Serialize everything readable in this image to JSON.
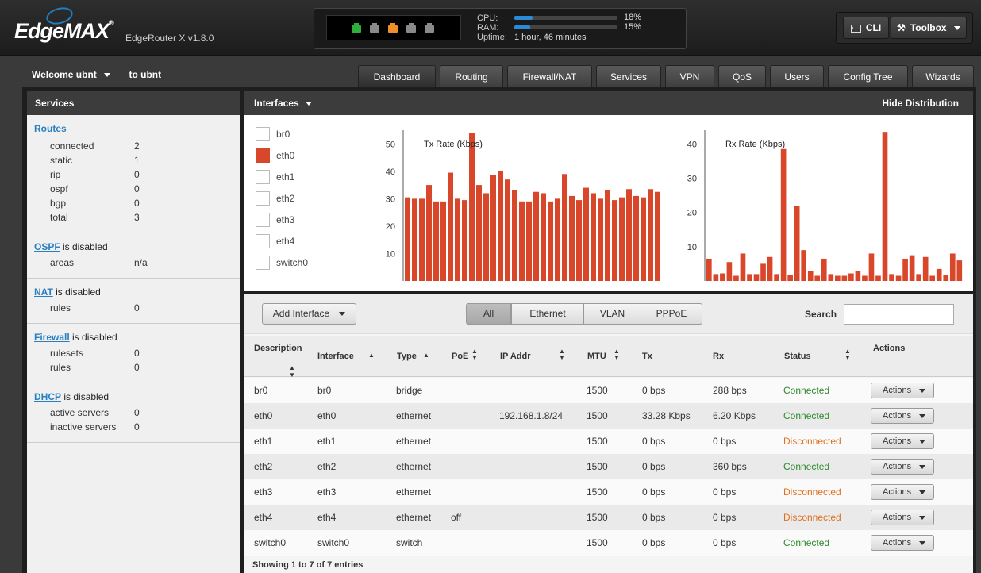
{
  "header": {
    "logo": "EdgeMAX",
    "model": "EdgeRouter X v1.8.0",
    "cpu_label": "CPU:",
    "ram_label": "RAM:",
    "uptime_label": "Uptime:",
    "cpu_pct": "18%",
    "ram_pct": "15%",
    "cpu_level": 0.18,
    "ram_level": 0.15,
    "uptime": "1 hour, 46 minutes",
    "ports": [
      {
        "color": "#2fae3c"
      },
      {
        "color": "#8a8a8a"
      },
      {
        "color": "#f0902a"
      },
      {
        "color": "#8a8a8a"
      },
      {
        "color": "#8a8a8a"
      }
    ],
    "cli_label": "CLI",
    "toolbox_label": "Toolbox"
  },
  "user": {
    "welcome": "Welcome ubnt",
    "to": "to ubnt"
  },
  "tabs": [
    "Dashboard",
    "Routing",
    "Firewall/NAT",
    "Services",
    "VPN",
    "QoS",
    "Users",
    "Config Tree",
    "Wizards"
  ],
  "services": {
    "title": "Services",
    "routes": {
      "title": "Routes",
      "rows": [
        {
          "k": "connected",
          "v": "2"
        },
        {
          "k": "static",
          "v": "1"
        },
        {
          "k": "rip",
          "v": "0"
        },
        {
          "k": "ospf",
          "v": "0"
        },
        {
          "k": "bgp",
          "v": "0"
        },
        {
          "k": "total",
          "v": "3"
        }
      ]
    },
    "ospf": {
      "title": "OSPF",
      "suffix": " is disabled",
      "rows": [
        {
          "k": "areas",
          "v": "n/a"
        }
      ]
    },
    "nat": {
      "title": "NAT",
      "suffix": " is disabled",
      "rows": [
        {
          "k": "rules",
          "v": "0"
        }
      ]
    },
    "firewall": {
      "title": "Firewall",
      "suffix": " is disabled",
      "rows": [
        {
          "k": "rulesets",
          "v": "0"
        },
        {
          "k": "rules",
          "v": "0"
        }
      ]
    },
    "dhcp": {
      "title": "DHCP",
      "suffix": " is disabled",
      "rows": [
        {
          "k": "active servers",
          "v": "0"
        },
        {
          "k": "inactive servers",
          "v": "0"
        }
      ]
    }
  },
  "interfaces_panel": {
    "title": "Interfaces",
    "hide_link": "Hide Distribution",
    "legend": [
      {
        "name": "br0",
        "checked": false
      },
      {
        "name": "eth0",
        "checked": true
      },
      {
        "name": "eth1",
        "checked": false
      },
      {
        "name": "eth2",
        "checked": false
      },
      {
        "name": "eth3",
        "checked": false
      },
      {
        "name": "eth4",
        "checked": false
      },
      {
        "name": "switch0",
        "checked": false
      }
    ],
    "bar_color": "#d9472b"
  },
  "chart_data": [
    {
      "type": "bar",
      "title": "Tx Rate (Kbps)",
      "series": [
        {
          "name": "eth0",
          "values": [
            30.5,
            30,
            30,
            35,
            29,
            29,
            39.5,
            30,
            29.5,
            54,
            35,
            32,
            38.5,
            40,
            37,
            33,
            29,
            29,
            32.5,
            32,
            29,
            30,
            39,
            31,
            29.5,
            34,
            32,
            30,
            33,
            29.5,
            30.5,
            33.5,
            31,
            30.5,
            33.5,
            32.5
          ]
        }
      ],
      "yticks": [
        10,
        20,
        30,
        40,
        50
      ],
      "ylim": [
        0,
        55
      ]
    },
    {
      "type": "bar",
      "title": "Rx Rate (Kbps)",
      "series": [
        {
          "name": "eth0",
          "values": [
            6.5,
            2,
            2.2,
            5.5,
            1.5,
            8,
            2,
            2,
            5,
            7,
            2,
            38.5,
            1.7,
            22,
            9,
            3,
            1.5,
            6.5,
            2,
            1.5,
            1.5,
            2.2,
            3,
            1.5,
            8,
            1.5,
            43.5,
            2,
            1.5,
            6.5,
            7.5,
            2,
            7,
            1.5,
            3.5,
            1.8,
            8,
            6
          ]
        }
      ],
      "yticks": [
        10,
        20,
        30,
        40
      ],
      "ylim": [
        0,
        44
      ]
    }
  ],
  "table": {
    "add_button": "Add Interface",
    "filters": [
      "All",
      "Ethernet",
      "VLAN",
      "PPPoE"
    ],
    "search_label": "Search",
    "columns": {
      "description": "Description",
      "interface": "Interface",
      "type": "Type",
      "poe": "PoE",
      "ip": "IP Addr",
      "mtu": "MTU",
      "tx": "Tx",
      "rx": "Rx",
      "status": "Status",
      "actions": "Actions"
    },
    "rows": [
      {
        "description": "br0",
        "interface": "br0",
        "type": "bridge",
        "poe": "",
        "ip": "",
        "mtu": "1500",
        "tx": "0 bps",
        "rx": "288 bps",
        "status": "Connected",
        "action": "Actions"
      },
      {
        "description": "eth0",
        "interface": "eth0",
        "type": "ethernet",
        "poe": "",
        "ip": "192.168.1.8/24",
        "mtu": "1500",
        "tx": "33.28 Kbps",
        "rx": "6.20 Kbps",
        "status": "Connected",
        "action": "Actions"
      },
      {
        "description": "eth1",
        "interface": "eth1",
        "type": "ethernet",
        "poe": "",
        "ip": "",
        "mtu": "1500",
        "tx": "0 bps",
        "rx": "0 bps",
        "status": "Disconnected",
        "action": "Actions"
      },
      {
        "description": "eth2",
        "interface": "eth2",
        "type": "ethernet",
        "poe": "",
        "ip": "",
        "mtu": "1500",
        "tx": "0 bps",
        "rx": "360 bps",
        "status": "Connected",
        "action": "Actions"
      },
      {
        "description": "eth3",
        "interface": "eth3",
        "type": "ethernet",
        "poe": "",
        "ip": "",
        "mtu": "1500",
        "tx": "0 bps",
        "rx": "0 bps",
        "status": "Disconnected",
        "action": "Actions"
      },
      {
        "description": "eth4",
        "interface": "eth4",
        "type": "ethernet",
        "poe": "off",
        "ip": "",
        "mtu": "1500",
        "tx": "0 bps",
        "rx": "0 bps",
        "status": "Disconnected",
        "action": "Actions"
      },
      {
        "description": "switch0",
        "interface": "switch0",
        "type": "switch",
        "poe": "",
        "ip": "",
        "mtu": "1500",
        "tx": "0 bps",
        "rx": "0 bps",
        "status": "Connected",
        "action": "Actions"
      }
    ],
    "footer": "Showing 1 to 7 of 7 entries"
  },
  "colors": {
    "connected": "#2d8a2d",
    "disconnected": "#e07020",
    "link": "#2a7fc0"
  }
}
